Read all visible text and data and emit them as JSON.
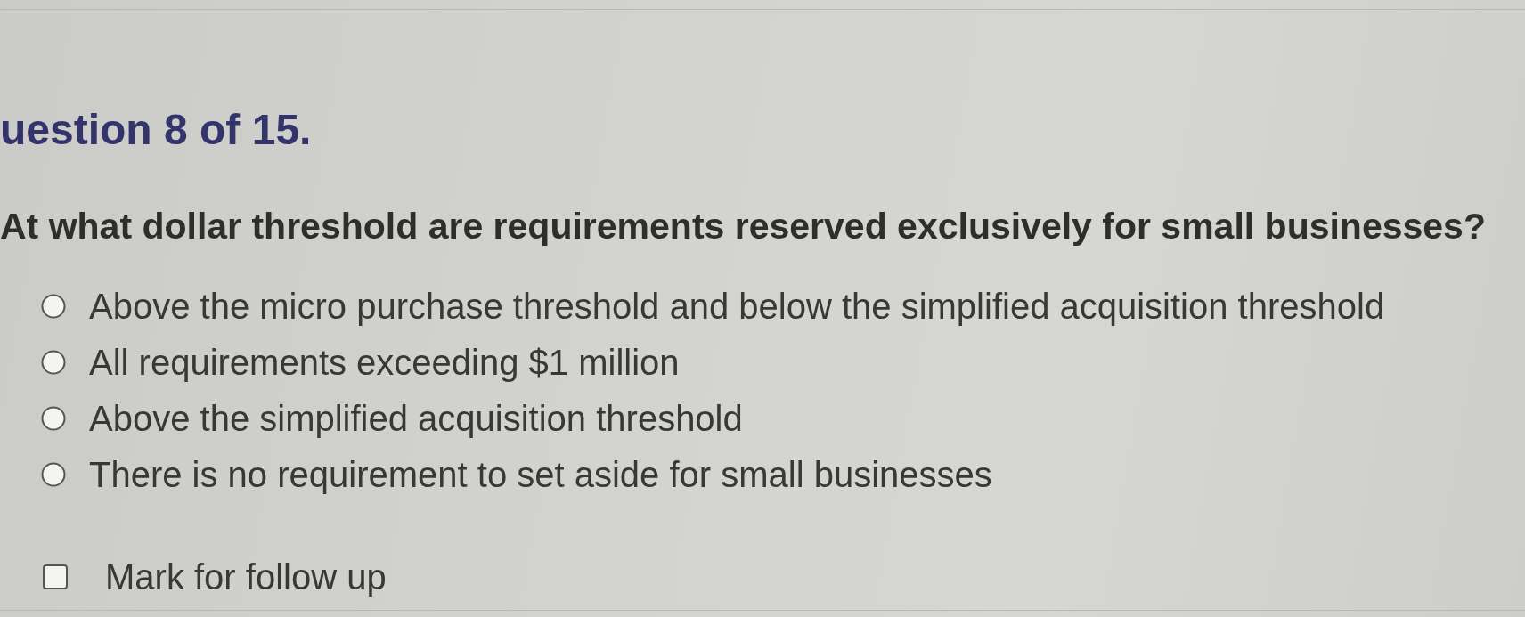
{
  "heading": "uestion 8 of 15.",
  "question": "At what dollar threshold are requirements reserved exclusively for small businesses?",
  "options": [
    {
      "label": "Above the micro purchase threshold and below the simplified acquisition threshold",
      "selected": false
    },
    {
      "label": "All requirements exceeding $1 million",
      "selected": false
    },
    {
      "label": "Above the simplified acquisition threshold",
      "selected": false
    },
    {
      "label": "There is no requirement to set aside for small businesses",
      "selected": false
    }
  ],
  "follow_up": {
    "label": "Mark for follow up",
    "checked": false
  }
}
